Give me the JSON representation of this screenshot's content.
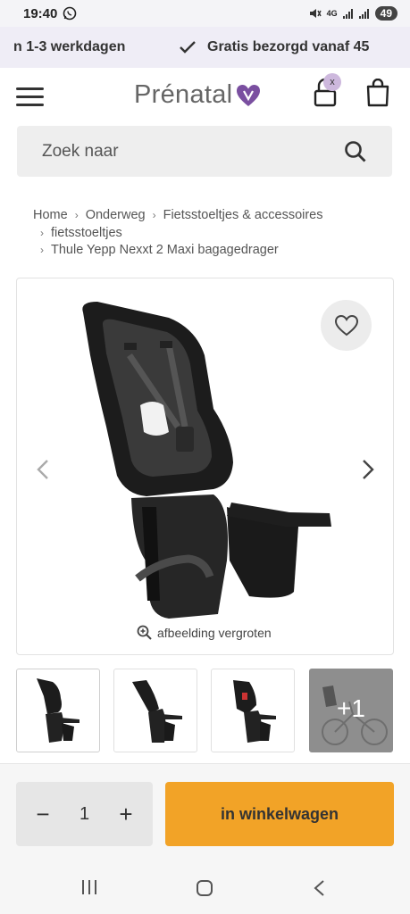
{
  "status": {
    "time": "19:40",
    "battery": "49",
    "network": "4G"
  },
  "usp": {
    "item1": "n 1-3 werkdagen",
    "item2": "Gratis bezorgd vanaf 45"
  },
  "header": {
    "logo": "Prénatal",
    "account_badge": "x"
  },
  "search": {
    "placeholder": "Zoek naar"
  },
  "breadcrumb": [
    "Home",
    "Onderweg",
    "Fietsstoeltjes & accessoires",
    "fietsstoeltjes",
    "Thule Yepp Nexxt 2 Maxi bagagedrager"
  ],
  "gallery": {
    "zoom_label": "afbeelding vergroten",
    "thumbnails": [
      "seat-front",
      "seat-side",
      "seat-back",
      "bike-mounted"
    ],
    "more_label": "+1"
  },
  "purchase": {
    "quantity": "1",
    "minus": "−",
    "plus": "+",
    "cart_label": "in winkelwagen"
  },
  "colors": {
    "accent": "#f2a327",
    "brand": "#7a4fa0",
    "banner_bg": "#efedf6"
  },
  "icons": [
    "whatsapp-icon",
    "check-icon",
    "menu-icon",
    "heart-logo-icon",
    "account-icon",
    "bag-icon",
    "search-icon",
    "favorite-heart-icon",
    "chevron-left-icon",
    "chevron-right-icon",
    "zoom-in-icon",
    "recent-apps-icon",
    "home-icon",
    "back-icon"
  ]
}
